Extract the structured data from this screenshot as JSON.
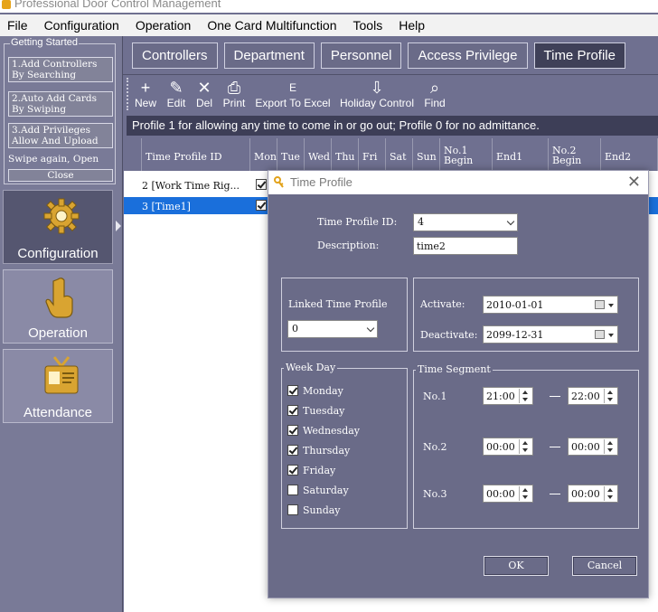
{
  "window": {
    "title": "Professional Door Control Management"
  },
  "menu": [
    "File",
    "Configuration",
    "Operation",
    "One Card Multifunction",
    "Tools",
    "Help"
  ],
  "getting_started": {
    "title": "Getting Started",
    "steps": [
      {
        "line1": "1.Add Controllers",
        "line2": "By Searching"
      },
      {
        "line1": "2.Auto Add Cards",
        "line2": "By Swiping"
      },
      {
        "line1": "3.Add Privileges",
        "line2": "Allow And Upload"
      }
    ],
    "note": "Swipe again, Open",
    "close": "Close"
  },
  "nav": [
    {
      "label": "Configuration",
      "icon": "gear-icon",
      "active": true
    },
    {
      "label": "Operation",
      "icon": "hand-pointer-icon",
      "active": false
    },
    {
      "label": "Attendance",
      "icon": "id-card-icon",
      "active": false
    }
  ],
  "tabs": [
    "Controllers",
    "Department",
    "Personnel",
    "Access Privilege",
    "Time Profile"
  ],
  "toolbar": [
    {
      "label": "New",
      "glyph": "+"
    },
    {
      "label": "Edit",
      "glyph": "✎"
    },
    {
      "label": "Del",
      "glyph": "✕"
    },
    {
      "label": "Print",
      "glyph": "⎙"
    },
    {
      "label": "Export To Excel",
      "glyph": "E"
    },
    {
      "label": "Holiday Control",
      "glyph": "⇩"
    },
    {
      "label": "Find",
      "glyph": "⌕"
    }
  ],
  "info": "Profile 1 for allowing any time to come in or go out; Profile 0  for no admittance.",
  "grid": {
    "columns": [
      {
        "l1": "Time Profile ID",
        "l2": ""
      },
      {
        "l1": "Mon",
        "l2": ""
      },
      {
        "l1": "Tue",
        "l2": ""
      },
      {
        "l1": "Wed",
        "l2": ""
      },
      {
        "l1": "Thu",
        "l2": ""
      },
      {
        "l1": "Fri",
        "l2": ""
      },
      {
        "l1": "Sat",
        "l2": ""
      },
      {
        "l1": "Sun",
        "l2": ""
      },
      {
        "l1": "No.1",
        "l2": "Begin"
      },
      {
        "l1": "End1",
        "l2": ""
      },
      {
        "l1": "No.2",
        "l2": "Begin"
      },
      {
        "l1": "End2",
        "l2": ""
      }
    ],
    "rows": [
      {
        "id": "2 [Work Time Rig...",
        "mon": true,
        "selected": false
      },
      {
        "id": "3 [Time1]",
        "mon": true,
        "selected": true
      }
    ]
  },
  "dialog": {
    "title": "Time Profile",
    "id_label": "Time Profile ID:",
    "id_value": "4",
    "desc_label": "Description:",
    "desc_value": "time2",
    "linked_label": "Linked Time Profile",
    "linked_value": "0",
    "activate_label": "Activate:",
    "activate_value": "2010-01-01",
    "deactivate_label": "Deactivate:",
    "deactivate_value": "2099-12-31",
    "weekday_title": "Week Day",
    "weekdays": [
      {
        "name": "Monday",
        "checked": true
      },
      {
        "name": "Tuesday",
        "checked": true
      },
      {
        "name": "Wednesday",
        "checked": true
      },
      {
        "name": "Thursday",
        "checked": true
      },
      {
        "name": "Friday",
        "checked": true
      },
      {
        "name": "Saturday",
        "checked": false
      },
      {
        "name": "Sunday",
        "checked": false
      }
    ],
    "segment_title": "Time Segment",
    "segments": [
      {
        "label": "No.1",
        "begin": "21:00",
        "end": "22:00"
      },
      {
        "label": "No.2",
        "begin": "00:00",
        "end": "00:00"
      },
      {
        "label": "No.3",
        "begin": "00:00",
        "end": "00:00"
      }
    ],
    "ok": "OK",
    "cancel": "Cancel"
  }
}
